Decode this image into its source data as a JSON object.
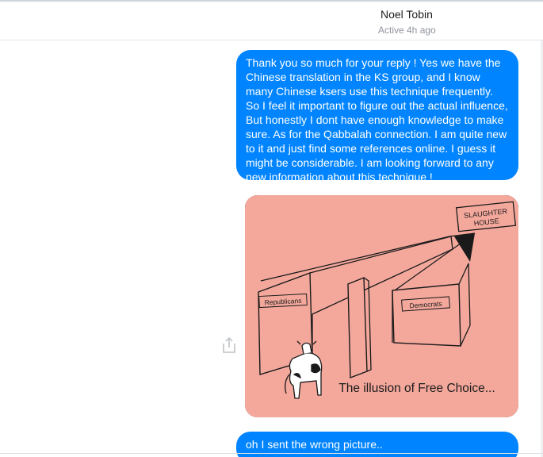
{
  "header": {
    "name": "Noel Tobin",
    "status": "Active 4h ago"
  },
  "messages": [
    {
      "text": "Thank you so much for your reply ! Yes we have the Chinese translation in the KS group, and I know many Chinese ksers use this technique frequently. So I feel it important to figure out the actual influence, But honestly I dont have enough knowledge to make sure. As for the Qabbalah connection. I am quite new to it and just find some references online. I guess it might be considerable. I am looking forward to any new information about this technique !"
    },
    {
      "image": {
        "labels": {
          "slaughter_house": [
            "SLAUGHTER",
            "HOUSE"
          ],
          "left_wall": "Republicans",
          "right_wall": "Democrats",
          "caption": "The illusion of Free Choice..."
        },
        "colors": {
          "background": "#f4a89c",
          "ink": "#1a1a1a"
        }
      }
    },
    {
      "text": "oh I sent the wrong picture.."
    }
  ],
  "icons": {
    "share": "share-icon"
  },
  "colors": {
    "bubble": "#0084ff",
    "bubble_text": "#ffffff",
    "status": "#90949c"
  }
}
